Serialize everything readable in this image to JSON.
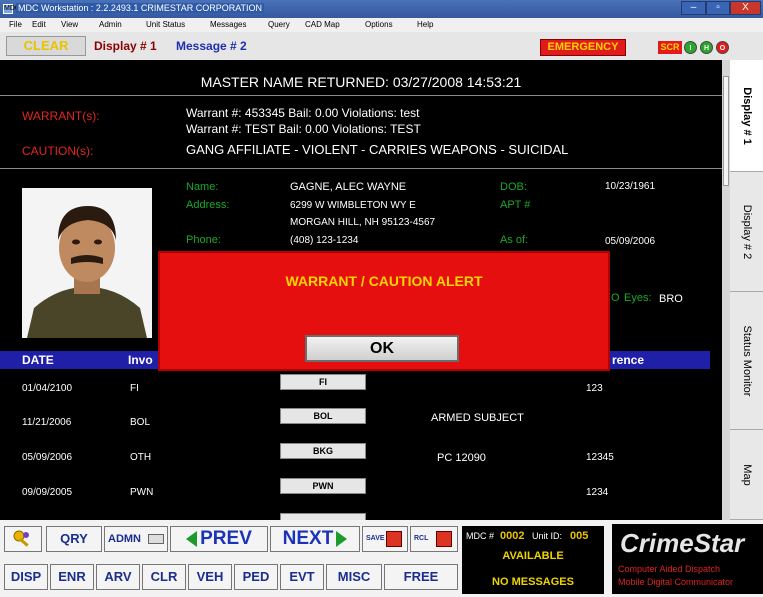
{
  "window": {
    "title": "MDC Workstation : 2.2.2493.1 CRIMESTAR CORPORATION",
    "icon_text": "MDC",
    "min": "–",
    "max": "▫",
    "close": "X"
  },
  "menu": [
    "File",
    "Edit",
    "View",
    "Admin",
    "Unit Status",
    "Messages",
    "Query",
    "CAD Map",
    "Options",
    "Help"
  ],
  "toolbar": {
    "clear": "CLEAR",
    "display": "Display # 1",
    "message": "Message # 2",
    "emergency": "EMERGENCY",
    "scr": "SCR",
    "dots": [
      "I",
      "H",
      "O"
    ]
  },
  "record": {
    "master_returned": "MASTER NAME RETURNED: 03/27/2008 14:53:21",
    "warrant_label": "WARRANT(s):",
    "warrants": [
      "Warrant #: 453345 Bail: 0.00 Violations: test",
      "Warrant #: TEST Bail: 0.00 Violations: TEST"
    ],
    "caution_label": "CAUTION(s):",
    "caution": "GANG AFFILIATE - VIOLENT - CARRIES WEAPONS - SUICIDAL",
    "name_label": "Name:",
    "name": "GAGNE, ALEC WAYNE",
    "address_label": "Address:",
    "address1": "6299 W WIMBLETON WY E",
    "address2": "MORGAN HILL, NH 95123-4567",
    "phone_label": "Phone:",
    "phone": "(408) 123-1234",
    "dob_label": "DOB:",
    "dob": "10/23/1961",
    "apt_label": "APT #",
    "asof_label": "As of:",
    "asof": "05/09/2006",
    "eyes_label": "Eyes:",
    "eyes": "BRO",
    "partial": "O"
  },
  "table": {
    "headers": [
      "DATE",
      "Invo",
      "rence"
    ],
    "rows": [
      {
        "date": "01/04/2100",
        "inv": "FI",
        "btn": "FI",
        "desc": "",
        "ref": "123"
      },
      {
        "date": "11/21/2006",
        "inv": "BOL",
        "btn": "BOL",
        "desc": "ARMED SUBJECT",
        "ref": ""
      },
      {
        "date": "05/09/2006",
        "inv": "OTH",
        "btn": "BKG",
        "desc": "PC 12090",
        "ref": "12345"
      },
      {
        "date": "09/09/2005",
        "inv": "PWN",
        "btn": "PWN",
        "desc": "",
        "ref": "1234"
      }
    ]
  },
  "alert": {
    "title": "WARRANT / CAUTION ALERT",
    "ok": "OK"
  },
  "side_tabs": [
    "Display # 1",
    "Display # 2",
    "Status Monitor",
    "Map"
  ],
  "bottom": {
    "qry": "QRY",
    "admin": "ADMN",
    "prev": "PREV",
    "next": "NEXT",
    "save": "SAVE",
    "rcl": "RCL",
    "buttons": [
      "DISP",
      "ENR",
      "ARV",
      "CLR",
      "VEH",
      "PED",
      "EVT",
      "MISC",
      "FREE"
    ],
    "mdc_label": "MDC #",
    "mdc": "0002",
    "unit_label": "Unit ID:",
    "unit": "005",
    "status": "AVAILABLE",
    "messages": "NO MESSAGES",
    "logo": "CrimeStar",
    "tag1": "Computer Aided Dispatch",
    "tag2": "Mobile Digital Communicator"
  },
  "colors": {
    "accent_blue": "#1f1fa8",
    "alert_red": "#e50f0f",
    "label_green": "#1ba82a",
    "warning_yellow": "#ffd400"
  }
}
